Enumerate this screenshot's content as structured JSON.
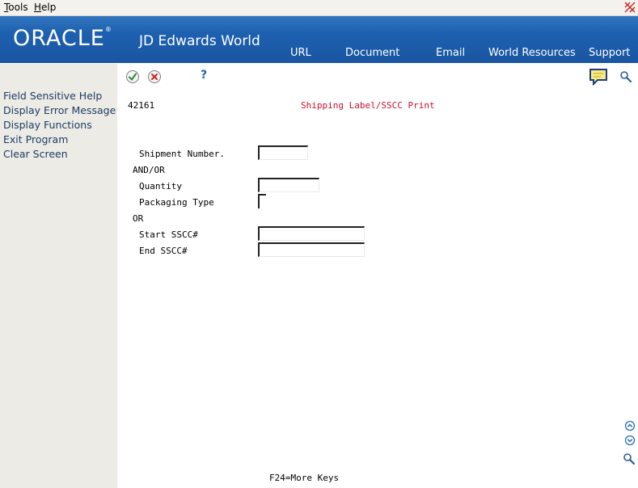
{
  "menubar": {
    "tools": {
      "accel": "T",
      "rest": "ools"
    },
    "help": {
      "accel": "H",
      "rest": "elp"
    }
  },
  "banner": {
    "logo_oracle": "ORACLE",
    "logo_registered": "®",
    "logo_product": "JD Edwards World",
    "nav": [
      "URL",
      "Document",
      "Email",
      "World Resources",
      "Support"
    ]
  },
  "sidebar": {
    "items": [
      "Field Sensitive Help",
      "Display Error Message",
      "Display Functions",
      "Exit Program",
      "Clear Screen"
    ]
  },
  "toolbar": {
    "help_glyph": "?"
  },
  "form": {
    "program_id": "42161",
    "title": "Shipping Label/SSCC Print",
    "labels": {
      "shipment_number": "Shipment Number.",
      "and_or": "AND/OR",
      "quantity": "Quantity",
      "packaging_type": "Packaging Type",
      "or": "OR",
      "start_sscc": "Start SSCC#",
      "end_sscc": "End SSCC#"
    },
    "values": {
      "shipment_number": "",
      "quantity": "",
      "packaging_type": "",
      "start_sscc": "",
      "end_sscc": ""
    },
    "footer": "F24=More Keys"
  },
  "colors": {
    "banner": "#1d5fae",
    "sidebar_bg": "#ecebe6",
    "title_red": "#c8102e",
    "link": "#1e3c64"
  }
}
